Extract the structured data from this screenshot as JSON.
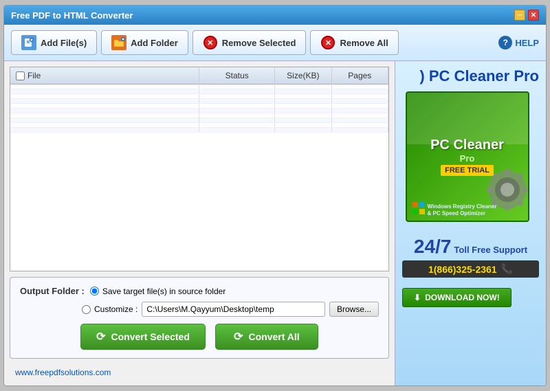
{
  "window": {
    "title": "Free PDF to HTML Converter"
  },
  "toolbar": {
    "add_files_label": "Add File(s)",
    "add_folder_label": "Add Folder",
    "remove_selected_label": "Remove Selected",
    "remove_all_label": "Remove All",
    "help_label": "HELP"
  },
  "table": {
    "col_file": "File",
    "col_status": "Status",
    "col_size": "Size(KB)",
    "col_pages": "Pages",
    "rows": []
  },
  "output": {
    "label": "Output Folder :",
    "option_source": "Save target file(s) in source folder",
    "option_customize": "Customize :",
    "customize_path": "C:\\Users\\M.Qayyum\\Desktop\\temp",
    "browse_label": "Browse..."
  },
  "buttons": {
    "convert_selected": "Convert Selected",
    "convert_all": "Convert All"
  },
  "footer": {
    "link_text": "www.freepdfsolutions.com"
  },
  "ad": {
    "title_part1": ") PC Cleaner Pro",
    "product_name": "PC Cleaner",
    "product_sub": "Pro",
    "free_trial": "FREE TRIAL",
    "support_247": "24/7",
    "support_text": "Toll Free Support",
    "phone": "1(866)325-2361",
    "download_label": "DOWNLOAD NOW!"
  }
}
